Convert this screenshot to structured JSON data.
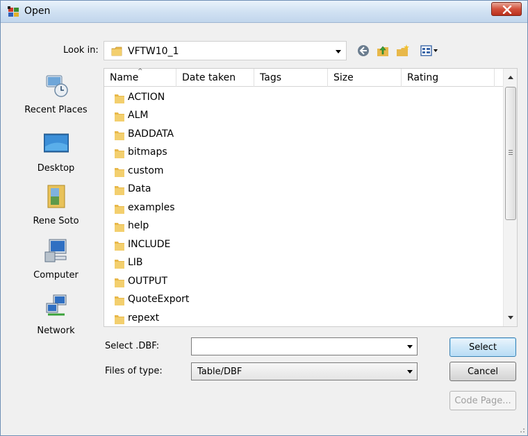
{
  "window": {
    "title": "Open",
    "close_icon": "close-x-icon"
  },
  "lookin": {
    "label": "Look in:",
    "value": "VFTW10_1"
  },
  "toolbar": {
    "icons": [
      "back-icon",
      "up-folder-icon",
      "new-folder-icon",
      "view-menu-icon"
    ]
  },
  "places": [
    {
      "label": "Recent Places",
      "icon": "recent-places-icon"
    },
    {
      "label": "Desktop",
      "icon": "desktop-icon"
    },
    {
      "label": "Rene Soto",
      "icon": "user-folder-icon"
    },
    {
      "label": "Computer",
      "icon": "computer-icon"
    },
    {
      "label": "Network",
      "icon": "network-icon"
    }
  ],
  "list": {
    "columns": [
      "Name",
      "Date taken",
      "Tags",
      "Size",
      "Rating"
    ],
    "items": [
      "ACTION",
      "ALM",
      "BADDATA",
      "bitmaps",
      "custom",
      "Data",
      "examples",
      "help",
      "INCLUDE",
      "LIB",
      "OUTPUT",
      "QuoteExport",
      "repext"
    ]
  },
  "form": {
    "select_label": "Select .DBF:",
    "select_value": "",
    "type_label": "Files of type:",
    "type_value": "Table/DBF"
  },
  "buttons": {
    "select": "Select",
    "cancel": "Cancel",
    "codepage": "Code Page..."
  },
  "colors": {
    "folder": "#e8b84a",
    "close": "#c9442e",
    "selection_border": "#3c7fb1"
  }
}
